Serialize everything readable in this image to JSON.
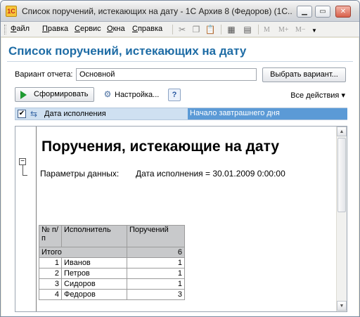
{
  "window": {
    "title": "Список поручений, истекающих на дату - 1С Архив 8 (Федоров) (1С...",
    "app_icon_text": "1С"
  },
  "menu": {
    "items": [
      "Файл",
      "Правка",
      "Сервис",
      "Окна",
      "Справка"
    ],
    "toolbar": {
      "memory_labels": [
        "M",
        "M+",
        "M−"
      ]
    }
  },
  "form": {
    "title": "Список поручений, истекающих на дату",
    "variant_label": "Вариант отчета:",
    "variant_value": "Основной",
    "choose_variant_button": "Выбрать вариант...",
    "generate_button": "Сформировать",
    "settings_label": "Настройка...",
    "help_label": "?",
    "all_actions": "Все действия",
    "filter": {
      "name": "Дата исполнения",
      "value": "Начало завтрашнего дня",
      "checked": true
    }
  },
  "report": {
    "title": "Поручения, истекающие на дату",
    "params_label": "Параметры данных:",
    "params_value": "Дата исполнения = 30.01.2009 0:00:00",
    "columns": [
      "№ п/п",
      "Исполнитель",
      "Поручений"
    ],
    "total_label": "Итого",
    "total_value": "6",
    "rows": [
      {
        "n": "1",
        "name": "Иванов",
        "count": "1"
      },
      {
        "n": "2",
        "name": "Петров",
        "count": "1"
      },
      {
        "n": "3",
        "name": "Сидоров",
        "count": "1"
      },
      {
        "n": "4",
        "name": "Федоров",
        "count": "3"
      }
    ]
  },
  "colors": {
    "form_title": "#1e6ca5",
    "filter_value_bg": "#5b9ad6",
    "table_header_bg": "#c8c9cb"
  }
}
